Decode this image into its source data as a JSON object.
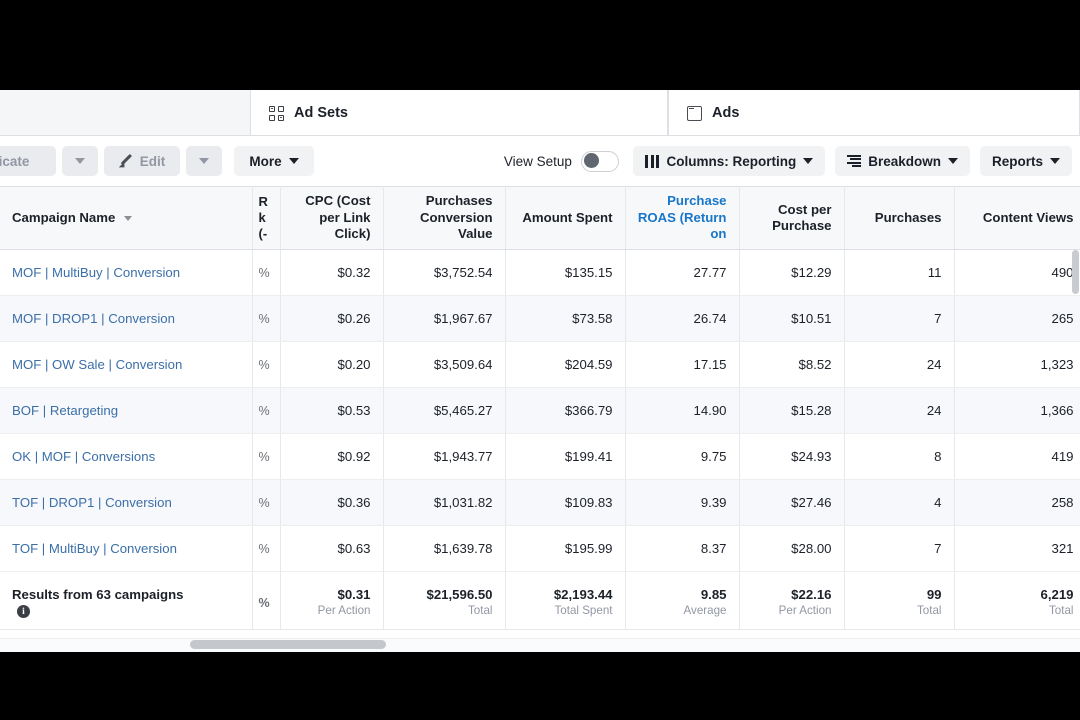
{
  "tabs": [
    {
      "label": "Ad Sets",
      "icon": "grid-icon"
    },
    {
      "label": "Ads",
      "icon": "window-icon"
    }
  ],
  "toolbar": {
    "duplicate_label": "Duplicate",
    "edit_label": "Edit",
    "more_label": "More",
    "view_setup_label": "View Setup",
    "view_setup_state": "off",
    "columns_label": "Columns: Reporting",
    "breakdown_label": "Breakdown",
    "reports_label": "Reports"
  },
  "table": {
    "headers": {
      "campaign_name": "Campaign Name",
      "partial": "R\nk\n(-",
      "cpc": "CPC (Cost per Link Click)",
      "purchases_conversion_value": "Purchases Conversion Value",
      "amount_spent": "Amount Spent",
      "purchase_roas": "Purchase ROAS (Return on",
      "cost_per_purchase": "Cost per Purchase",
      "purchases": "Purchases",
      "content_views": "Content Views"
    },
    "rows": [
      {
        "name": "MOF | MultiBuy | Conversion",
        "partial": "%",
        "cpc": "$0.32",
        "pcv": "$3,752.54",
        "spent": "$135.15",
        "roas": "27.77",
        "cpp": "$12.29",
        "purchases": "11",
        "views": "490"
      },
      {
        "name": "MOF | DROP1 | Conversion",
        "partial": "%",
        "cpc": "$0.26",
        "pcv": "$1,967.67",
        "spent": "$73.58",
        "roas": "26.74",
        "cpp": "$10.51",
        "purchases": "7",
        "views": "265"
      },
      {
        "name": "MOF | OW Sale | Conversion",
        "partial": "%",
        "cpc": "$0.20",
        "pcv": "$3,509.64",
        "spent": "$204.59",
        "roas": "17.15",
        "cpp": "$8.52",
        "purchases": "24",
        "views": "1,323"
      },
      {
        "name": "BOF | Retargeting",
        "partial": "%",
        "cpc": "$0.53",
        "pcv": "$5,465.27",
        "spent": "$366.79",
        "roas": "14.90",
        "cpp": "$15.28",
        "purchases": "24",
        "views": "1,366"
      },
      {
        "name": "OK | MOF | Conversions",
        "partial": "%",
        "cpc": "$0.92",
        "pcv": "$1,943.77",
        "spent": "$199.41",
        "roas": "9.75",
        "cpp": "$24.93",
        "purchases": "8",
        "views": "419"
      },
      {
        "name": "TOF | DROP1 | Conversion",
        "partial": "%",
        "cpc": "$0.36",
        "pcv": "$1,031.82",
        "spent": "$109.83",
        "roas": "9.39",
        "cpp": "$27.46",
        "purchases": "4",
        "views": "258"
      },
      {
        "name": "TOF | MultiBuy | Conversion",
        "partial": "%",
        "cpc": "$0.63",
        "pcv": "$1,639.78",
        "spent": "$195.99",
        "roas": "8.37",
        "cpp": "$28.00",
        "purchases": "7",
        "views": "321"
      }
    ],
    "totals": {
      "label": "Results from 63 campaigns",
      "partial": "%",
      "cpc": "$0.31",
      "cpc_sub": "Per Action",
      "pcv": "$21,596.50",
      "pcv_sub": "Total",
      "spent": "$2,193.44",
      "spent_sub": "Total Spent",
      "roas": "9.85",
      "roas_sub": "Average",
      "cpp": "$22.16",
      "cpp_sub": "Per Action",
      "purchases": "99",
      "purchases_sub": "Total",
      "views": "6,219",
      "views_sub": "Total"
    }
  },
  "colors": {
    "link": "#3b6fa8",
    "accent_blue": "#1877c9",
    "highlight_border": "#b52323"
  }
}
